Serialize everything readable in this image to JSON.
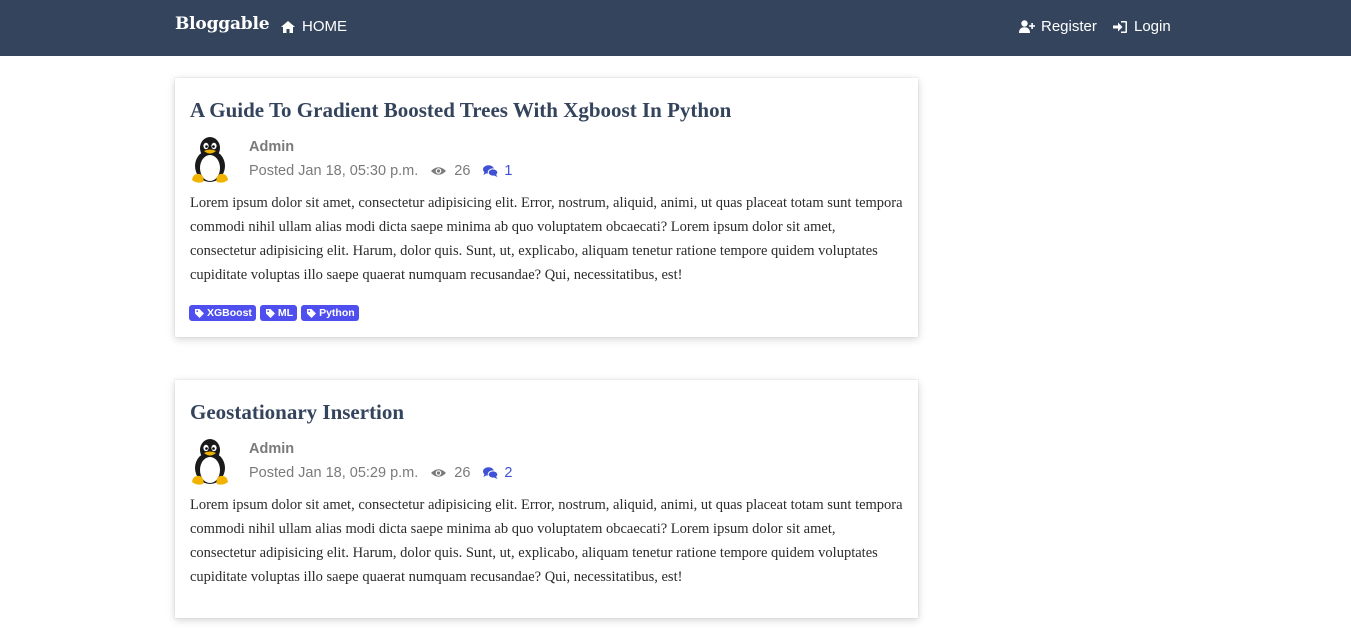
{
  "navbar": {
    "brand": "Bloggable",
    "home_label": "HOME",
    "register_label": "Register",
    "login_label": "Login",
    "background_color": "#34445c"
  },
  "posts": [
    {
      "title": "A Guide To Gradient Boosted Trees With Xgboost In Python",
      "author": "Admin",
      "posted": "Posted Jan 18, 05:30 p.m.",
      "views": "26",
      "comments": "1",
      "body": "Lorem ipsum dolor sit amet, consectetur adipisicing elit. Error, nostrum, aliquid, animi, ut quas placeat totam sunt tempora commodi nihil ullam alias modi dicta saepe minima ab quo voluptatem obcaecati? Lorem ipsum dolor sit amet, consectetur adipisicing elit. Harum, dolor quis. Sunt, ut, explicabo, aliquam tenetur ratione tempore quidem voluptates cupiditate voluptas illo saepe quaerat numquam recusandae? Qui, necessitatibus, est!",
      "tags": [
        "XGBoost",
        "ML",
        "Python"
      ]
    },
    {
      "title": "Geostationary Insertion",
      "author": "Admin",
      "posted": "Posted Jan 18, 05:29 p.m.",
      "views": "26",
      "comments": "2",
      "body": "Lorem ipsum dolor sit amet, consectetur adipisicing elit. Error, nostrum, aliquid, animi, ut quas placeat totam sunt tempora commodi nihil ullam alias modi dicta saepe minima ab quo voluptatem obcaecati? Lorem ipsum dolor sit amet, consectetur adipisicing elit. Harum, dolor quis. Sunt, ut, explicabo, aliquam tenetur ratione tempore quidem voluptates cupiditate voluptas illo saepe quaerat numquam recusandae? Qui, necessitatibus, est!",
      "tags": []
    }
  ],
  "icons": {
    "home": "home-icon",
    "register": "user-plus-icon",
    "login": "sign-in-icon",
    "views": "eye-icon",
    "comments": "comments-icon",
    "tag": "tag-icon",
    "avatar": "tux-penguin-avatar"
  },
  "colors": {
    "title": "#34445c",
    "accent": "#3f51d4",
    "tag_background": "#4f4ff0",
    "muted_text": "#7a7a7a"
  }
}
